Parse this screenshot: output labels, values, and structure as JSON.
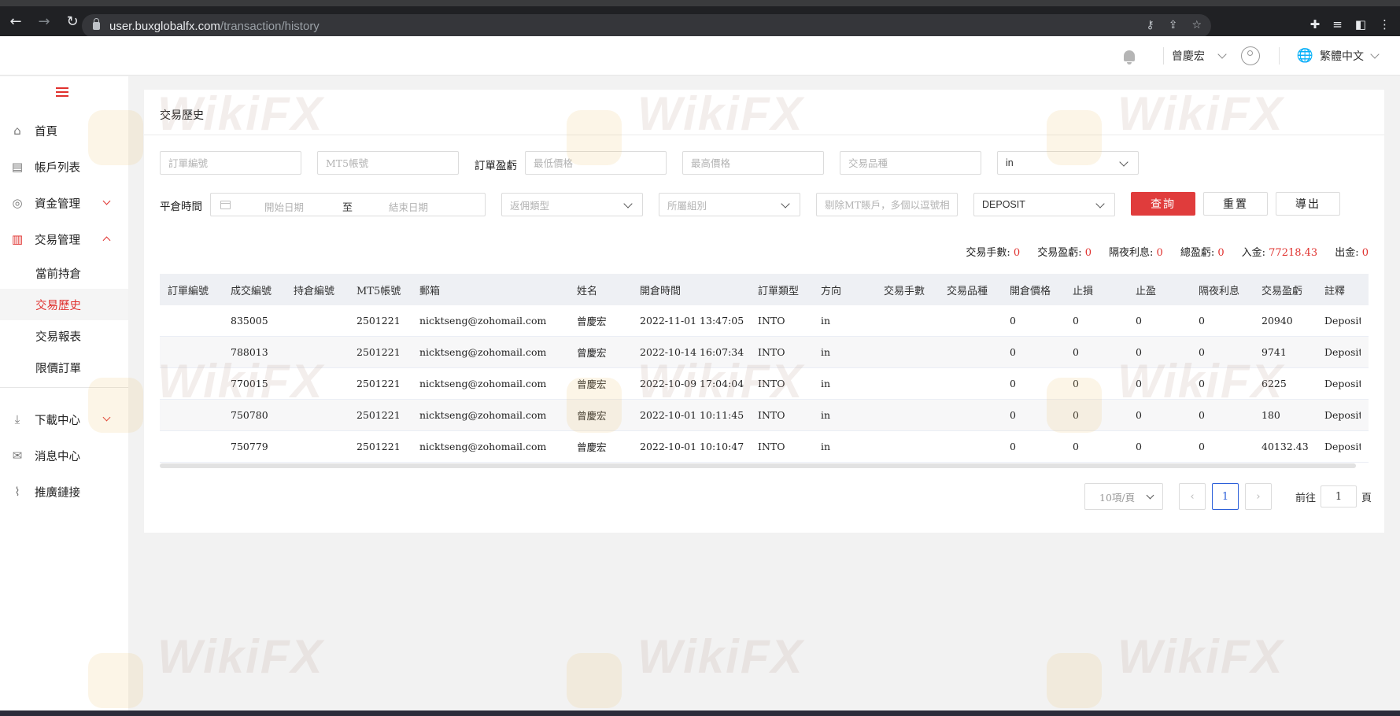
{
  "browser": {
    "url_host": "user.buxglobalfx.com",
    "url_path": "/transaction/history"
  },
  "header": {
    "user_name": "曾慶宏",
    "language": "繁體中文"
  },
  "sidebar": {
    "items": [
      {
        "label": "首頁",
        "icon": "home-icon"
      },
      {
        "label": "帳戶列表",
        "icon": "account-list-icon"
      },
      {
        "label": "資金管理",
        "icon": "fund-icon"
      },
      {
        "label": "交易管理",
        "icon": "barcode-icon"
      },
      {
        "label": "下載中心",
        "icon": "download-icon"
      },
      {
        "label": "消息中心",
        "icon": "mail-icon"
      },
      {
        "label": "推廣鏈接",
        "icon": "link-icon"
      }
    ],
    "sub_items": [
      "當前持倉",
      "交易歷史",
      "交易報表",
      "限價訂單"
    ]
  },
  "page": {
    "title": "交易歷史"
  },
  "filters": {
    "order_no_placeholder": "訂單編號",
    "mt5_placeholder": "MT5帳號",
    "profit_label": "訂單盈虧",
    "min_price_placeholder": "最低價格",
    "max_price_placeholder": "最高價格",
    "symbol_placeholder": "交易品種",
    "direction_value": "in",
    "close_time_label": "平倉時間",
    "start_date_placeholder": "開始日期",
    "to_label": "至",
    "end_date_placeholder": "結束日期",
    "rebate_type_placeholder": "返佣類型",
    "group_placeholder": "所屬組別",
    "exclude_placeholder": "剔除MT賬戶，多個以逗號相隔",
    "type_value": "DEPOSIT"
  },
  "buttons": {
    "query": "查詢",
    "reset": "重置",
    "export": "導出"
  },
  "summary": [
    {
      "label": "交易手數:",
      "value": "0"
    },
    {
      "label": "交易盈虧:",
      "value": "0"
    },
    {
      "label": "隔夜利息:",
      "value": "0"
    },
    {
      "label": "總盈虧:",
      "value": "0"
    },
    {
      "label": "入金:",
      "value": "77218.43"
    },
    {
      "label": "出金:",
      "value": "0"
    }
  ],
  "table": {
    "columns": [
      "訂單編號",
      "成交編號",
      "持倉編號",
      "MT5帳號",
      "郵箱",
      "姓名",
      "開倉時間",
      "訂單類型",
      "方向",
      "交易手數",
      "交易品種",
      "開倉價格",
      "止損",
      "止盈",
      "隔夜利息",
      "交易盈虧",
      "註釋"
    ],
    "rows": [
      [
        "",
        "835005",
        "",
        "2501221",
        "nicktseng@zohomail.com",
        "曾慶宏",
        "2022-11-01 13:47:05",
        "INTO",
        "in",
        "",
        "",
        "0",
        "0",
        "0",
        "0",
        "20940",
        "Deposit"
      ],
      [
        "",
        "788013",
        "",
        "2501221",
        "nicktseng@zohomail.com",
        "曾慶宏",
        "2022-10-14 16:07:34",
        "INTO",
        "in",
        "",
        "",
        "0",
        "0",
        "0",
        "0",
        "9741",
        "Deposit"
      ],
      [
        "",
        "770015",
        "",
        "2501221",
        "nicktseng@zohomail.com",
        "曾慶宏",
        "2022-10-09 17:04:04",
        "INTO",
        "in",
        "",
        "",
        "0",
        "0",
        "0",
        "0",
        "6225",
        "Deposit"
      ],
      [
        "",
        "750780",
        "",
        "2501221",
        "nicktseng@zohomail.com",
        "曾慶宏",
        "2022-10-01 10:11:45",
        "INTO",
        "in",
        "",
        "",
        "0",
        "0",
        "0",
        "0",
        "180",
        "Deposit"
      ],
      [
        "",
        "750779",
        "",
        "2501221",
        "nicktseng@zohomail.com",
        "曾慶宏",
        "2022-10-01 10:10:47",
        "INTO",
        "in",
        "",
        "",
        "0",
        "0",
        "0",
        "0",
        "40132.43",
        "Deposit"
      ]
    ]
  },
  "pagination": {
    "page_size": "10項/頁",
    "current_page": "1",
    "goto_label": "前往",
    "goto_value": "1",
    "page_unit": "頁"
  },
  "watermark": "WikiFX",
  "colors": {
    "accent": "#e0312e",
    "primary_button": "#e03c3c",
    "pagination_active": "#2b5fd9"
  }
}
